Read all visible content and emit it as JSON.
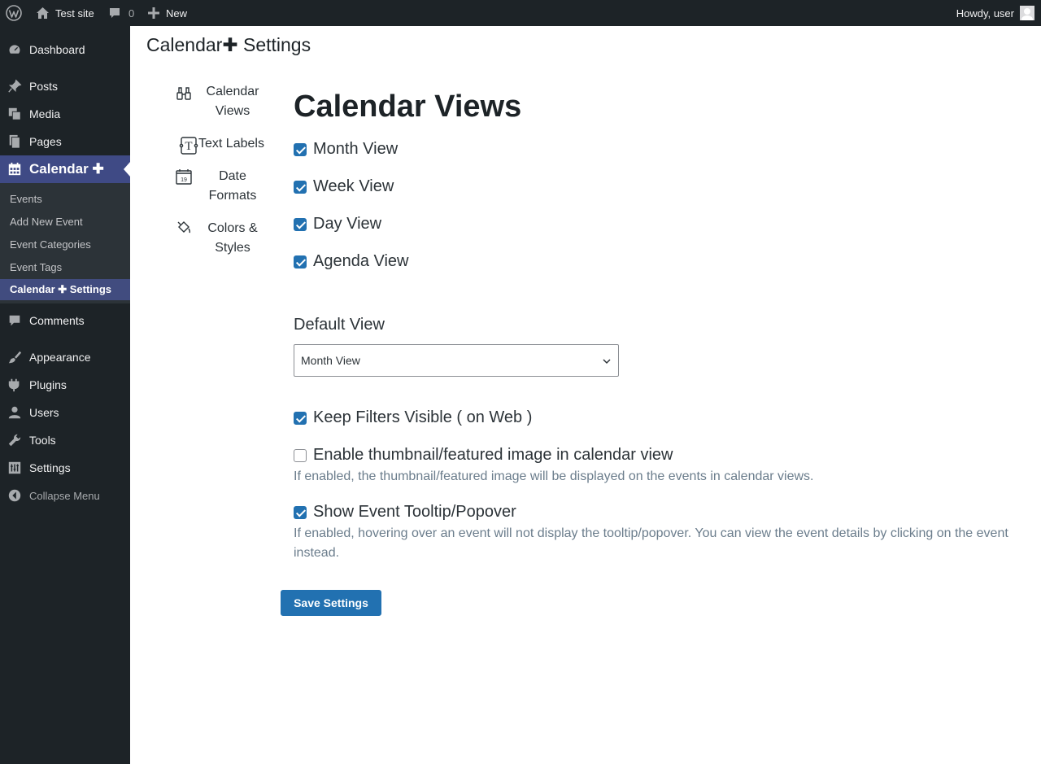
{
  "adminbar": {
    "site_name": "Test site",
    "comments_count": "0",
    "new_label": "New",
    "howdy": "Howdy, user"
  },
  "sidebar": {
    "items": [
      {
        "label": "Dashboard",
        "icon": "dashboard-icon"
      },
      {
        "label": "Posts",
        "icon": "pin-icon"
      },
      {
        "label": "Media",
        "icon": "media-icon"
      },
      {
        "label": "Pages",
        "icon": "pages-icon"
      },
      {
        "label": "Calendar ✚",
        "icon": "calendar-icon"
      },
      {
        "label": "Comments",
        "icon": "comment-icon"
      },
      {
        "label": "Appearance",
        "icon": "paintbrush-icon"
      },
      {
        "label": "Plugins",
        "icon": "plugin-icon"
      },
      {
        "label": "Users",
        "icon": "user-icon"
      },
      {
        "label": "Tools",
        "icon": "wrench-icon"
      },
      {
        "label": "Settings",
        "icon": "settings-icon"
      },
      {
        "label": "Collapse Menu",
        "icon": "collapse-icon"
      }
    ],
    "submenu": [
      "Events",
      "Add New Event",
      "Event Categories",
      "Event Tags",
      "Calendar ✚  Settings"
    ]
  },
  "page": {
    "title": "Calendar✚ Settings"
  },
  "tabs": [
    {
      "label": "Calendar Views",
      "icon": "binoculars-icon"
    },
    {
      "label": "Text Labels",
      "icon": "text-labels-icon"
    },
    {
      "label": "Date Formats",
      "icon": "date-calendar-icon"
    },
    {
      "label": "Colors & Styles",
      "icon": "paint-bucket-icon"
    }
  ],
  "section": {
    "title": "Calendar Views",
    "views": [
      {
        "label": "Month View",
        "checked": true
      },
      {
        "label": "Week View",
        "checked": true
      },
      {
        "label": "Day View",
        "checked": true
      },
      {
        "label": "Agenda View",
        "checked": true
      }
    ],
    "default_view_label": "Default View",
    "default_view_value": "Month View",
    "keep_filters": {
      "label": "Keep Filters Visible ( on Web )",
      "checked": true
    },
    "thumbnail": {
      "label": "Enable thumbnail/featured image in calendar view",
      "checked": false,
      "help": "If enabled, the thumbnail/featured image will be displayed on the events in calendar views."
    },
    "tooltip": {
      "label": "Show Event Tooltip/Popover",
      "checked": true,
      "help": "If enabled, hovering over an event will not display the tooltip/popover. You can view the event details by clicking on the event instead."
    }
  },
  "save_label": "Save Settings",
  "colors": {
    "admin_bg": "#1d2327",
    "accent": "#2271b1",
    "current_menu": "#3f4a85"
  }
}
